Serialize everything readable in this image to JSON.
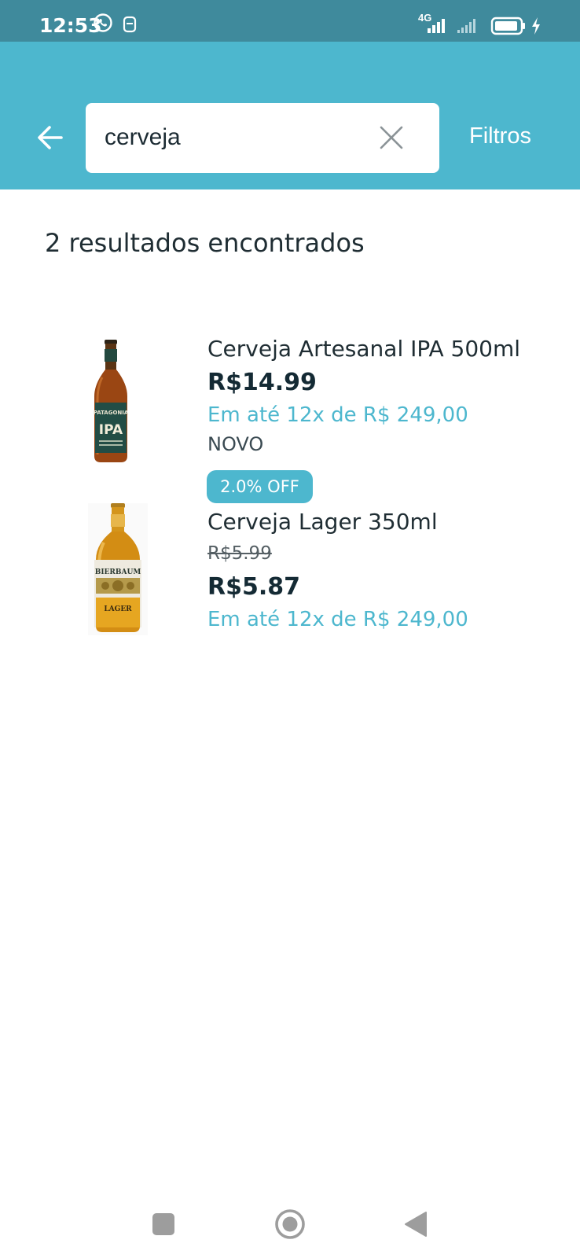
{
  "status_bar": {
    "time": "12:53",
    "network": "4G",
    "icons": [
      "whatsapp-icon",
      "sim-icon",
      "signal-icon",
      "battery-icon",
      "charging-icon"
    ]
  },
  "header": {
    "back_icon": "arrow-left-icon",
    "search_value": "cerveja",
    "clear_icon": "close-icon",
    "filters_label": "Filtros"
  },
  "results": {
    "count_text": "2 resultados encontrados",
    "items": [
      {
        "title": "Cerveja Artesanal IPA 500ml",
        "price": "R$14.99",
        "installment": "Em até 12x de R$ 249,00",
        "condition": "NOVO",
        "discount": "2.0% OFF",
        "label_brand": "PATAGONIA",
        "label_style": "IPA"
      },
      {
        "title": "Cerveja Lager 350ml",
        "old_price": "R$5.99",
        "price": "R$5.87",
        "installment": "Em até 12x de R$ 249,00",
        "label_brand": "BIERBAUM",
        "label_style": "LAGER"
      }
    ]
  },
  "nav_bar": {
    "icons": [
      "recents-icon",
      "home-icon",
      "back-triangle-icon"
    ]
  },
  "colors": {
    "status_bar": "#3f8a9c",
    "header": "#4db7ce",
    "accent": "#4db7ce",
    "text": "#1f2d33"
  }
}
